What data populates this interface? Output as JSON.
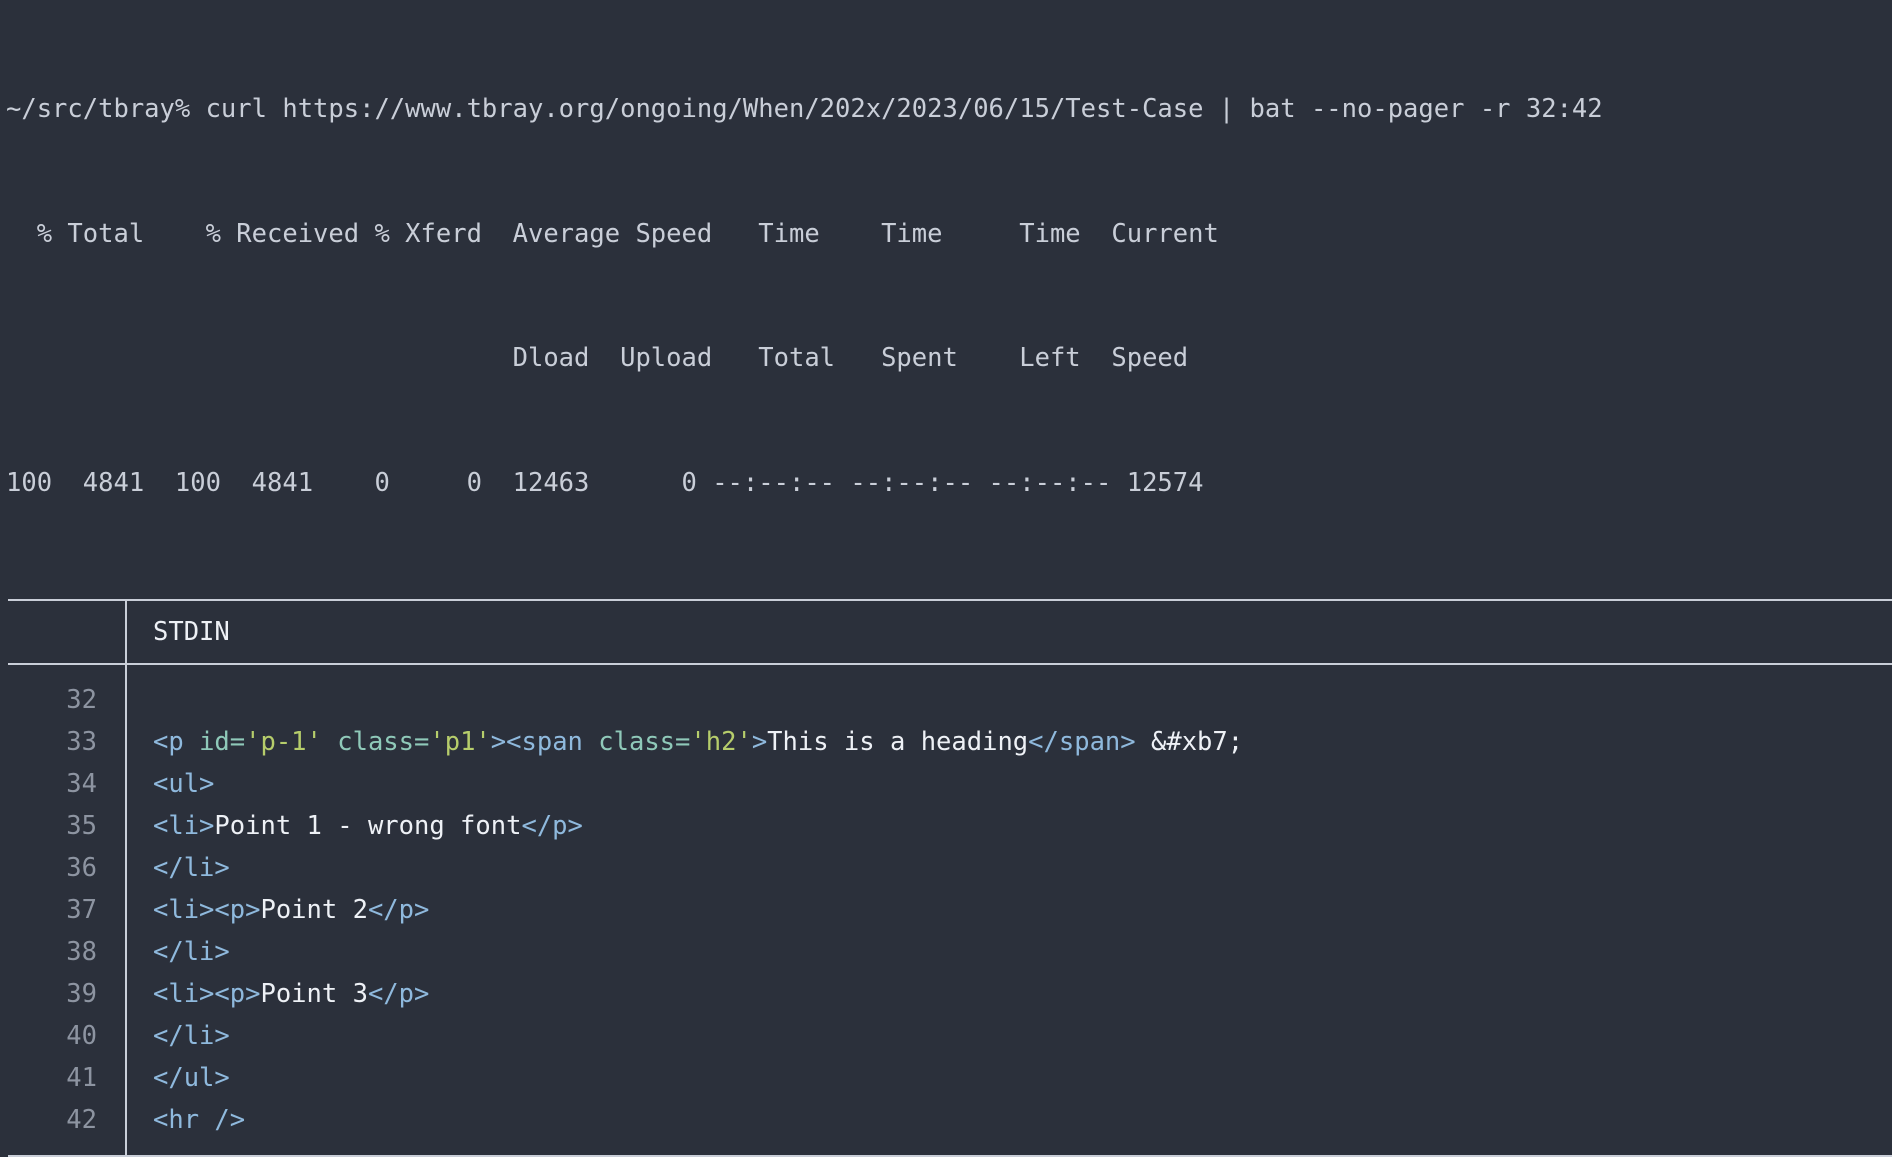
{
  "terminal": {
    "background_color": "#2b303b",
    "foreground_color": "#c9ced8",
    "prompt": "~/src/tbray% ",
    "command": "curl https://www.tbray.org/ongoing/When/202x/2023/06/15/Test-Case | bat --no-pager -r 32:42",
    "command_full_line": "~/src/tbray% curl https://www.tbray.org/ongoing/When/202x/2023/06/15/Test-Case | bat --no-pager -r 32:42"
  },
  "curl_progress": {
    "header_line_1": "  % Total    % Received % Xferd  Average Speed   Time    Time     Time  Current",
    "header_line_2": "                                 Dload  Upload   Total   Spent    Left  Speed",
    "stats_line": "100  4841  100  4841    0     0  12463      0 --:--:-- --:--:-- --:--:-- 12574",
    "percent_total": "100",
    "total": "4841",
    "percent_received": "100",
    "received": "4841",
    "percent_xferd": "0",
    "xferd": "0",
    "average_speed_dload": "12463",
    "average_speed_upload": "0",
    "time_total": "--:--:--",
    "time_spent": "--:--:--",
    "time_left": "--:--:--",
    "current_speed": "12574"
  },
  "bat": {
    "file_title": "STDIN",
    "gutter_color": "#8d94a1",
    "rule_color": "#c9ced8",
    "lines": [
      {
        "number": "32",
        "tokens": []
      },
      {
        "number": "33",
        "tokens": [
          {
            "text": "<p ",
            "type": "tag"
          },
          {
            "text": "id=",
            "type": "attr"
          },
          {
            "text": "'p-1'",
            "type": "val"
          },
          {
            "text": " ",
            "type": "tag"
          },
          {
            "text": "class=",
            "type": "attr"
          },
          {
            "text": "'p1'",
            "type": "val"
          },
          {
            "text": "><span ",
            "type": "tag"
          },
          {
            "text": "class=",
            "type": "attr"
          },
          {
            "text": "'h2'",
            "type": "val"
          },
          {
            "text": ">",
            "type": "tag"
          },
          {
            "text": "This is a heading",
            "type": "text"
          },
          {
            "text": "</span>",
            "type": "tag"
          },
          {
            "text": " &#xb7;",
            "type": "text"
          }
        ]
      },
      {
        "number": "34",
        "tokens": [
          {
            "text": "<ul>",
            "type": "tag"
          }
        ]
      },
      {
        "number": "35",
        "tokens": [
          {
            "text": "<li>",
            "type": "tag"
          },
          {
            "text": "Point 1 - wrong font",
            "type": "text"
          },
          {
            "text": "</p>",
            "type": "tag"
          }
        ]
      },
      {
        "number": "36",
        "tokens": [
          {
            "text": "</li>",
            "type": "tag"
          }
        ]
      },
      {
        "number": "37",
        "tokens": [
          {
            "text": "<li><p>",
            "type": "tag"
          },
          {
            "text": "Point 2",
            "type": "text"
          },
          {
            "text": "</p>",
            "type": "tag"
          }
        ]
      },
      {
        "number": "38",
        "tokens": [
          {
            "text": "</li>",
            "type": "tag"
          }
        ]
      },
      {
        "number": "39",
        "tokens": [
          {
            "text": "<li><p>",
            "type": "tag"
          },
          {
            "text": "Point 3",
            "type": "text"
          },
          {
            "text": "</p>",
            "type": "tag"
          }
        ]
      },
      {
        "number": "40",
        "tokens": [
          {
            "text": "</li>",
            "type": "tag"
          }
        ]
      },
      {
        "number": "41",
        "tokens": [
          {
            "text": "</ul>",
            "type": "tag"
          }
        ]
      },
      {
        "number": "42",
        "tokens": [
          {
            "text": "<hr />",
            "type": "tag"
          }
        ]
      }
    ]
  },
  "syntax_colors": {
    "tag": "#8fb9dd",
    "attr": "#8fc9b9",
    "val": "#b6cd6b",
    "text": "#eef1f6"
  }
}
